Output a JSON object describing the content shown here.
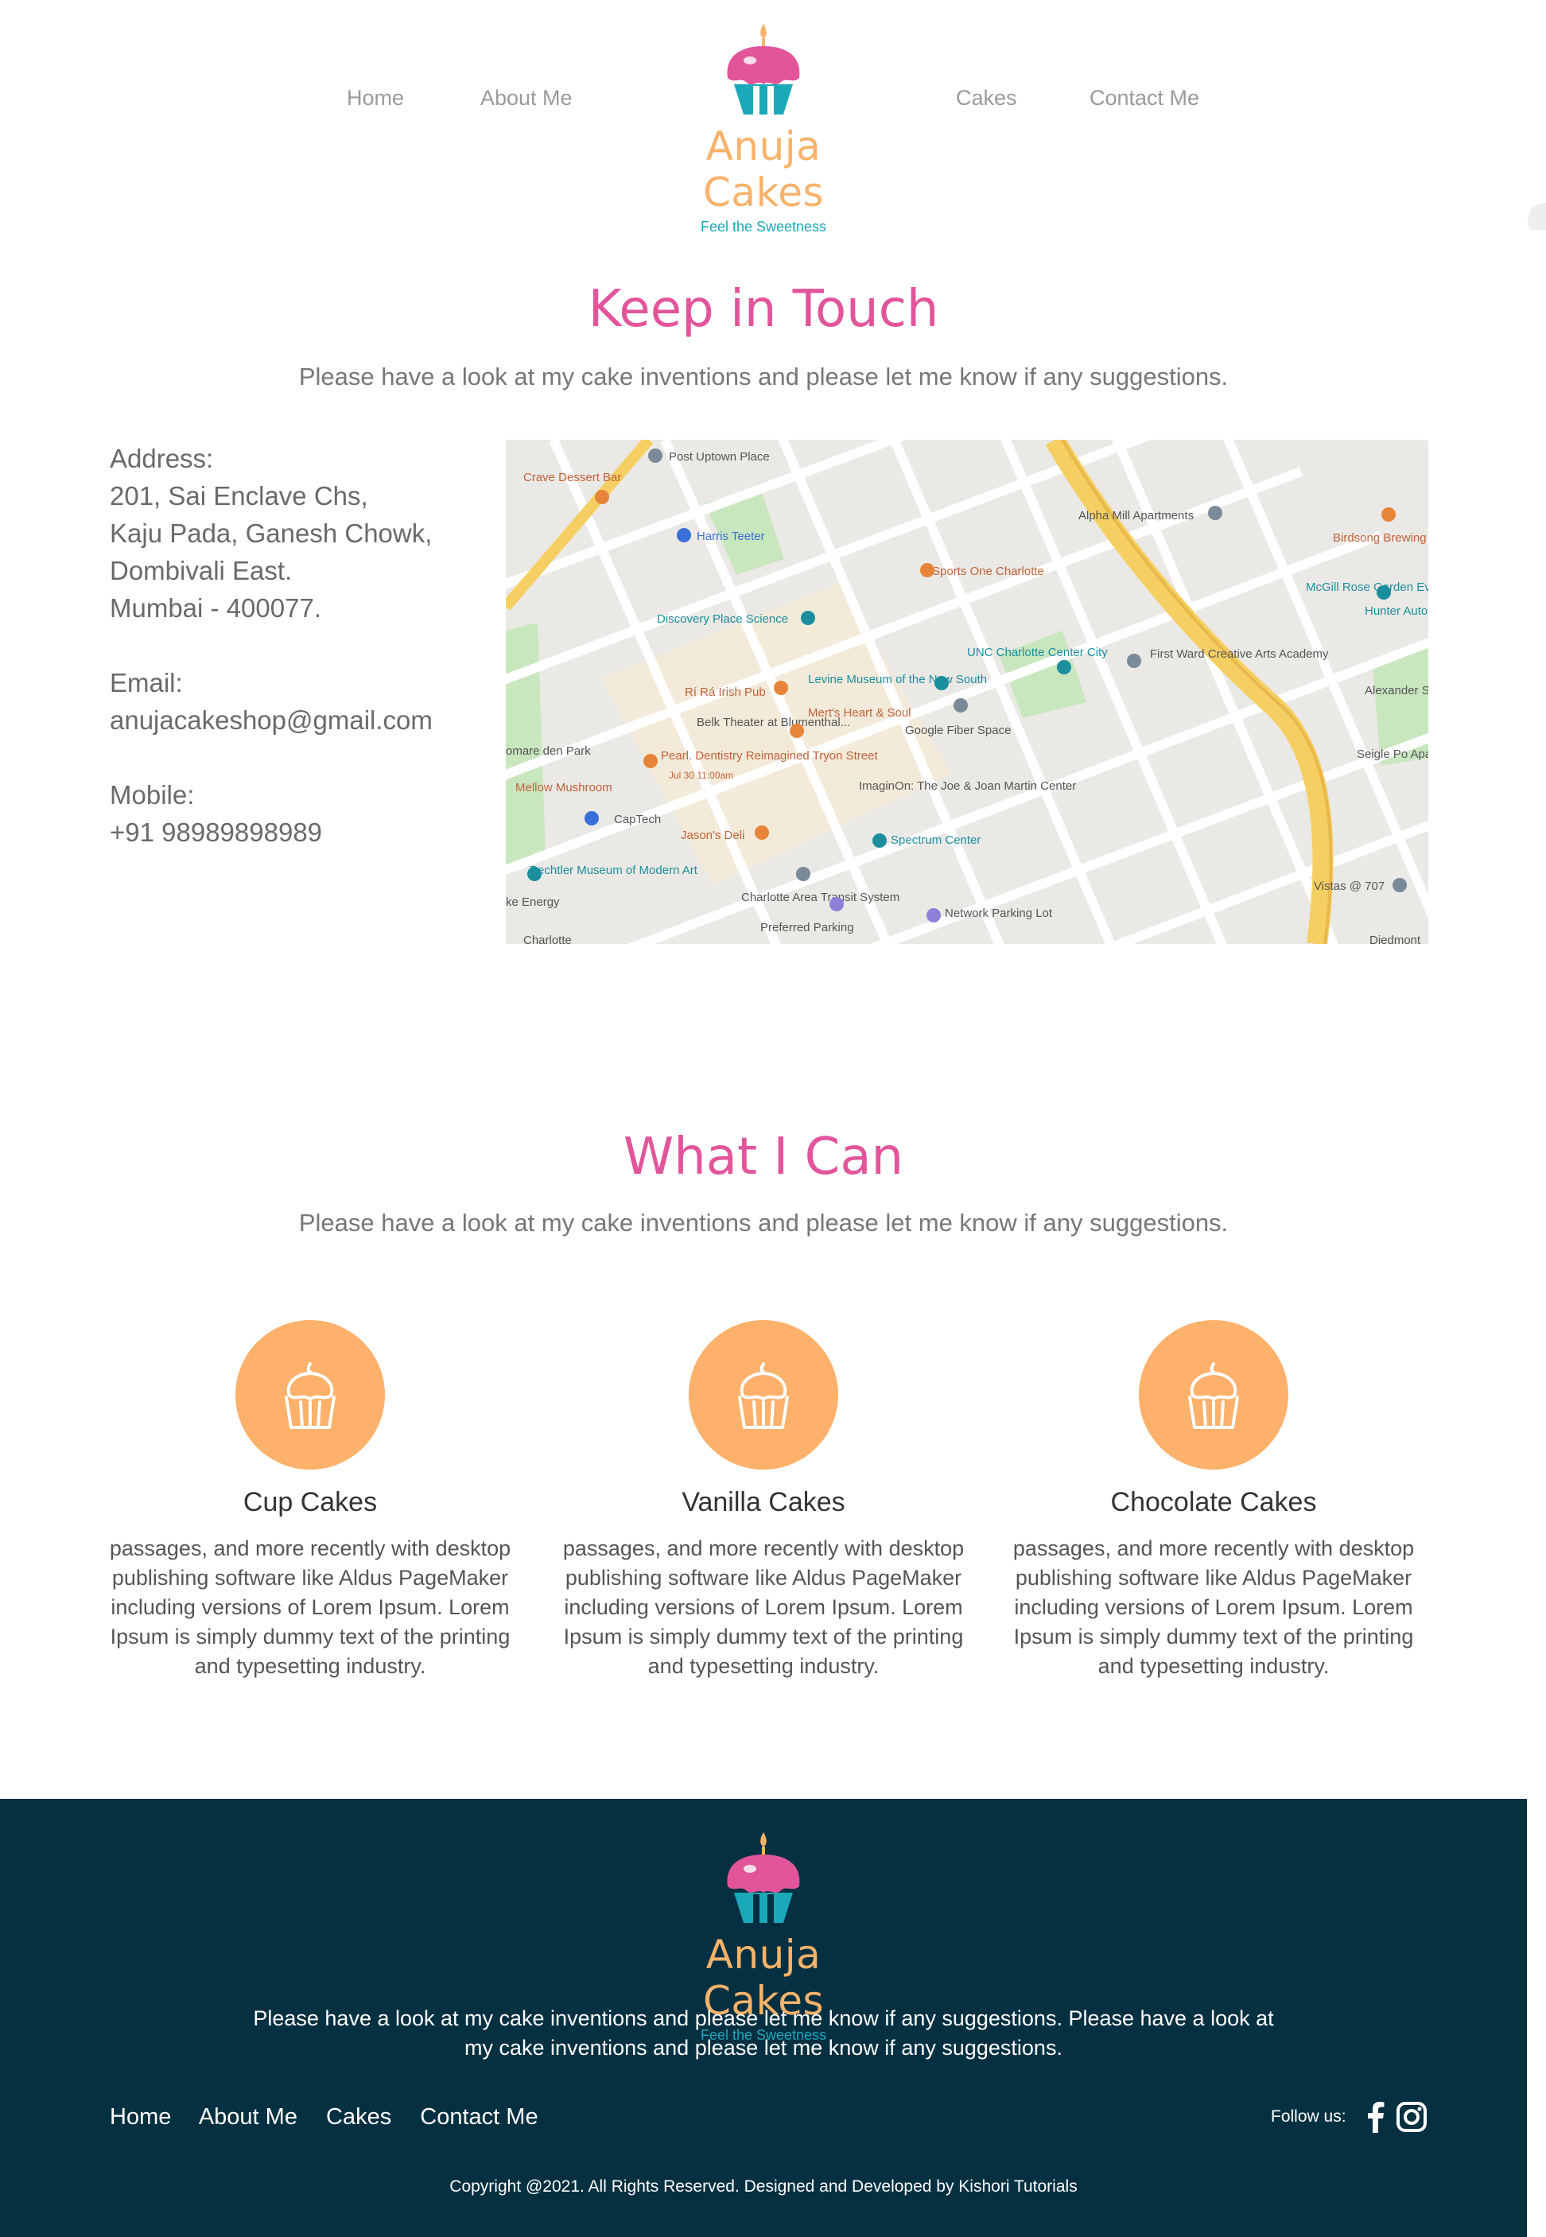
{
  "header": {
    "nav_left": [
      "Home",
      "About Me"
    ],
    "nav_right": [
      "Cakes",
      "Contact Me"
    ],
    "brand": "Anuja Cakes",
    "tagline": "Feel the Sweetness"
  },
  "contact": {
    "title": "Keep in Touch",
    "subtitle": "Please have a look at my cake inventions and please let me know if any suggestions.",
    "address_label": "Address:",
    "address_lines": [
      "201, Sai Enclave Chs,",
      "Kaju Pada, Ganesh Chowk,",
      "Dombivali East.",
      "Mumbai - 400077."
    ],
    "email_label": "Email:",
    "email": "anujacakeshop@gmail.com",
    "mobile_label": "Mobile:",
    "mobile": "+91 98989898989",
    "map_labels": {
      "crave": "Crave Dessert Bar",
      "post_uptown": "Post Uptown Place",
      "harris": "Harris Teeter",
      "alpha": "Alpha Mill Apartments",
      "hunter": "Hunter Auto Wrecker Serv",
      "birdsong": "Birdsong Brewing C",
      "sports": "Sports One Charlotte",
      "mcgill": "McGill Rose Garden Events",
      "discovery": "Discovery Place Science",
      "unc": "UNC Charlotte Center City",
      "first_ward": "First Ward Creative Arts Academy",
      "rira": "Rí Rá Irish Pub",
      "levine": "Levine Museum of the New South",
      "merts": "Mert's Heart & Soul",
      "alexander": "Alexander Street Park",
      "belk": "Belk Theater at Blumenthal...",
      "google_fiber": "Google Fiber Space",
      "pearl": "Pearl. Dentistry Reimagined Tryon Street",
      "pearl_date": "Jul 30 11:00am",
      "seigle": "Seigle Po Apartment Hon",
      "imaginon": "ImaginOn: The Joe & Joan Martin Center",
      "mellow": "Mellow Mushroom",
      "captech": "CapTech",
      "jasons": "Jason's Deli",
      "spectrum": "Spectrum Center",
      "bechtler": "Bechtler Museum of Modern Art",
      "transit": "Charlotte Area Transit System",
      "preferred": "Preferred Parking",
      "network": "Network Parking Lot",
      "vistas": "Vistas @ 707",
      "energy": "ke Energy",
      "marepark": "omare den Park",
      "charlotte": "Charlotte",
      "diedmont": "Diedmont"
    }
  },
  "services": {
    "title": "What I Can",
    "subtitle": "Please have a look at my cake inventions and please let me know if any suggestions.",
    "items": [
      {
        "title": "Cup Cakes",
        "desc": "passages, and more recently with desktop publishing software like Aldus PageMaker including versions of Lorem Ipsum. Lorem Ipsum is simply dummy text of the printing and typesetting industry.",
        "icon": "cupcake-icon"
      },
      {
        "title": "Vanilla Cakes",
        "desc": "passages, and more recently with desktop publishing software like Aldus PageMaker including versions of Lorem Ipsum. Lorem Ipsum is simply dummy text of the printing and typesetting industry.",
        "icon": "cupcake-icon"
      },
      {
        "title": "Chocolate Cakes",
        "desc": "passages, and more recently with desktop publishing software like Aldus PageMaker including versions of Lorem Ipsum. Lorem Ipsum is simply dummy text of the printing and typesetting industry.",
        "icon": "cupcake-icon"
      }
    ]
  },
  "footer": {
    "brand": "Anuja Cakes",
    "tagline": "Feel the Sweetness",
    "text": "Please have a look at my cake inventions and please let me know if any suggestions. Please have a look at my cake inventions and please let me know if any suggestions.",
    "nav": [
      "Home",
      "About Me",
      "Cakes",
      "Contact Me"
    ],
    "follow_label": "Follow us:",
    "social_icons": [
      "facebook-icon",
      "instagram-icon"
    ],
    "copyright": "Copyright @2021. All Rights Reserved. Designed and Developed by Kishori Tutorials"
  },
  "colors": {
    "pink": "#e2559b",
    "orange": "#fdb16b",
    "teal": "#19a9b9",
    "footer_bg": "#043041"
  }
}
